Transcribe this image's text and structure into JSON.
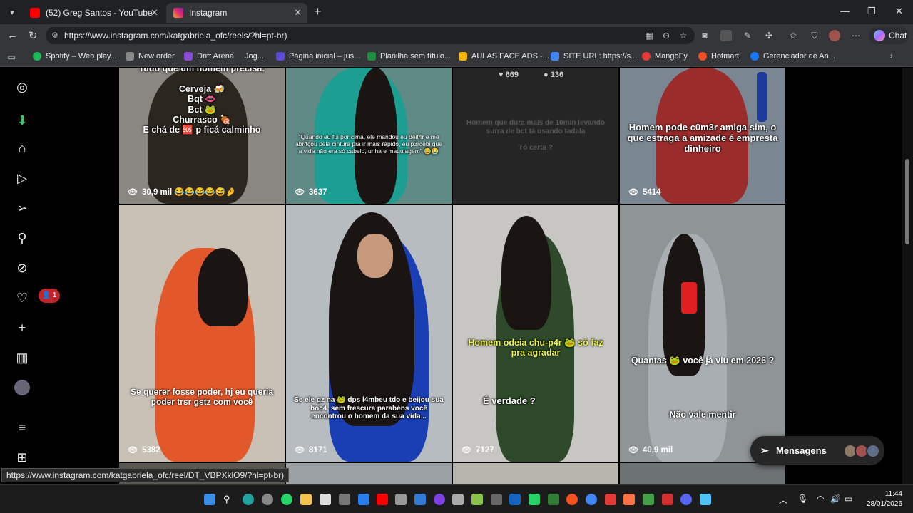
{
  "browser": {
    "tabs": [
      {
        "title": "(52) Greg Santos - YouTube",
        "favicon": "youtube-icon"
      },
      {
        "title": "Instagram",
        "favicon": "instagram-icon",
        "active": true
      }
    ],
    "url": "https://www.instagram.com/katgabriela_ofc/reels/?hl=pt-br)",
    "chat_label": "Chat",
    "bookmarks": [
      {
        "label": "Spotify – Web play...",
        "color": "#1db954"
      },
      {
        "label": "New order",
        "color": "#888888"
      },
      {
        "label": "Drift Arena",
        "color": "#8a4bd6"
      },
      {
        "label": "Jog...",
        "color": "#e8eaed"
      },
      {
        "label": "Página inicial – jus...",
        "color": "#5b4bd6"
      },
      {
        "label": "Planilha sem título...",
        "color": "#1e8e3e"
      },
      {
        "label": "AULAS FACE ADS -...",
        "color": "#f4b400"
      },
      {
        "label": "SITE URL: https://s...",
        "color": "#4285f4"
      },
      {
        "label": "MangoFy",
        "color": "#e53935"
      },
      {
        "label": "Hotmart",
        "color": "#f04e23"
      },
      {
        "label": "Gerenciador de An...",
        "color": "#1877f2"
      }
    ]
  },
  "instagram": {
    "notif_count": "1",
    "tiles": [
      {
        "views": "30,9 mil 😂😂😂😂😅🤌",
        "caption": "Tudo que um homem precisa:\n\nCerveja 🍻\nBqt 👄\nBct 🐸\nChurrasco 🍖\nE chá de 🆘 p ficá calminho",
        "bg": "#8a8682"
      },
      {
        "views": "3637",
        "caption": "\"Quando eu fui por cima, ele mandou eu deit4r e me abr4çou pela cintura pra ir mais rápido, eu p3rcebi que a vida não era só cabelo, unha e maquiagem\" 😂😭",
        "bg": "#5f8a86"
      },
      {
        "likes": "669",
        "comments": "136",
        "caption": "Homem que dura mais de 10min levando surra de bct tá usando tadala\n\nTô certa ?",
        "bg": "#252525"
      },
      {
        "views": "5414",
        "caption": "Homem pode c0m3r amiga sim, o que estraga a amizade é empresta dinheiro",
        "bg": "#7a8691"
      },
      {
        "views": "5382",
        "caption": "Se querer fosse poder, hj eu queria poder trsr gstz com você",
        "bg": "#c9c1b6"
      },
      {
        "views": "8171",
        "caption": "Se ele gz na 🐸 dps l4mbeu tdo e beijou sua boc4, sem frescura parabéns você encontrou o homem da sua vida...",
        "bg": "#b7bcc0"
      },
      {
        "views": "7127",
        "caption": "Homem odeia chu-p4r 🐸 só faz pra agradar",
        "caption2": "É verdade ?",
        "bg": "#c8c6c2"
      },
      {
        "views": "40,9 mil",
        "caption": "Quantas 🐸 você já viu em 2026 ?",
        "caption2": "Não vale mentir",
        "bg": "#8f9496"
      }
    ],
    "messages_label": "Mensagens",
    "status_link": "https://www.instagram.com/katgabriela_ofc/reel/DT_VBPXklO9/?hl=pt-br)"
  },
  "taskbar": {
    "time": "11:44",
    "date": "28/01/2026"
  }
}
